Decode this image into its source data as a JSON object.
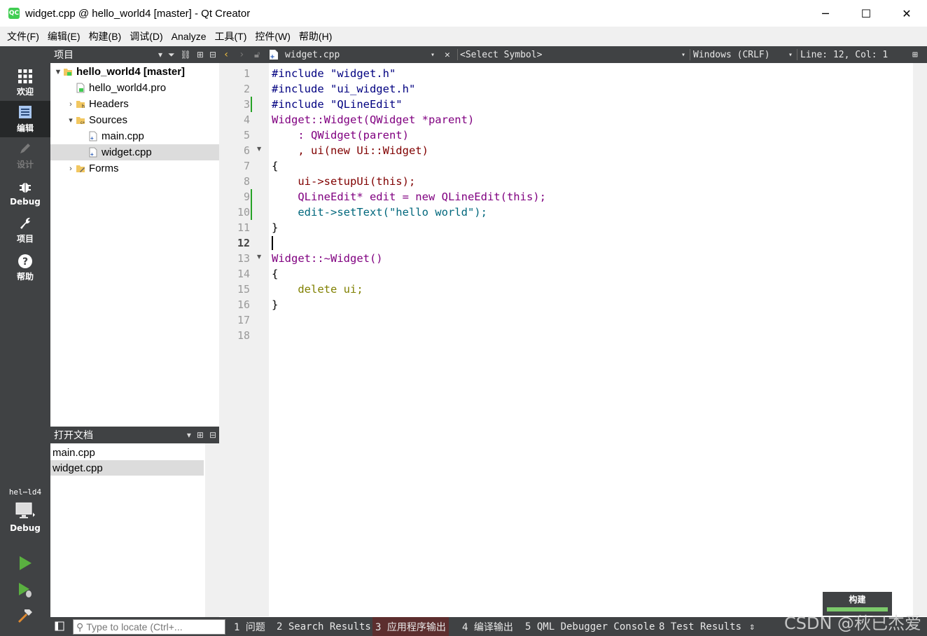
{
  "window": {
    "title": "widget.cpp @ hello_world4 [master] - Qt Creator",
    "app_icon": "QC",
    "minimize": "─",
    "maximize": "☐",
    "close": "✕"
  },
  "menu": [
    "文件(F)",
    "编辑(E)",
    "构建(B)",
    "调试(D)",
    "Analyze",
    "工具(T)",
    "控件(W)",
    "帮助(H)"
  ],
  "modes": [
    {
      "label": "欢迎",
      "icon": "grid-icon"
    },
    {
      "label": "编辑",
      "icon": "edit-doc-icon"
    },
    {
      "label": "设计",
      "icon": "pencil-icon"
    },
    {
      "label": "Debug",
      "icon": "bug-icon"
    },
    {
      "label": "项目",
      "icon": "wrench-icon"
    },
    {
      "label": "帮助",
      "icon": "help-icon"
    }
  ],
  "kit": {
    "name": "hel⋯ld4",
    "build": "Debug"
  },
  "projects_panel": {
    "title": "项目",
    "tree": [
      {
        "label": "hello_world4 [master]",
        "bold": true
      },
      {
        "label": "hello_world4.pro"
      },
      {
        "label": "Headers"
      },
      {
        "label": "Sources"
      },
      {
        "label": "main.cpp"
      },
      {
        "label": "widget.cpp"
      },
      {
        "label": "Forms"
      }
    ]
  },
  "open_docs": {
    "title": "打开文档",
    "items": [
      "main.cpp",
      "widget.cpp"
    ]
  },
  "editor_toolbar": {
    "filename": "widget.cpp",
    "symbol": "<Select Symbol>",
    "line_ending": "Windows (CRLF)",
    "position": "Line: 12, Col: 1"
  },
  "line_numbers": [
    "1",
    "2",
    "3",
    "4",
    "5",
    "6",
    "7",
    "8",
    "9",
    "10",
    "11",
    "12",
    "13",
    "14",
    "15",
    "16",
    "17",
    "18"
  ],
  "code_lines": [
    "#include \"widget.h\"",
    "#include \"ui_widget.h\"",
    "#include \"QLineEdit\"",
    "Widget::Widget(QWidget *parent)",
    "    : QWidget(parent)",
    "    , ui(new Ui::Widget)",
    "{",
    "    ui->setupUi(this);",
    "    QLineEdit* edit = new QLineEdit(this);",
    "    edit->setText(\"hello world\");",
    "}",
    "",
    "Widget::~Widget()",
    "{",
    "    delete ui;",
    "}",
    "",
    ""
  ],
  "build_badge": {
    "label": "构建",
    "progress": 1.0
  },
  "locator": {
    "placeholder": "Type to locate (Ctrl+..."
  },
  "output_tabs": [
    "1 问题",
    "2 Search Results",
    "3 应用程序输出",
    "4 编译输出",
    "5 QML Debugger Console",
    "8 Test Results"
  ],
  "watermark": "CSDN @秋已杰爱"
}
